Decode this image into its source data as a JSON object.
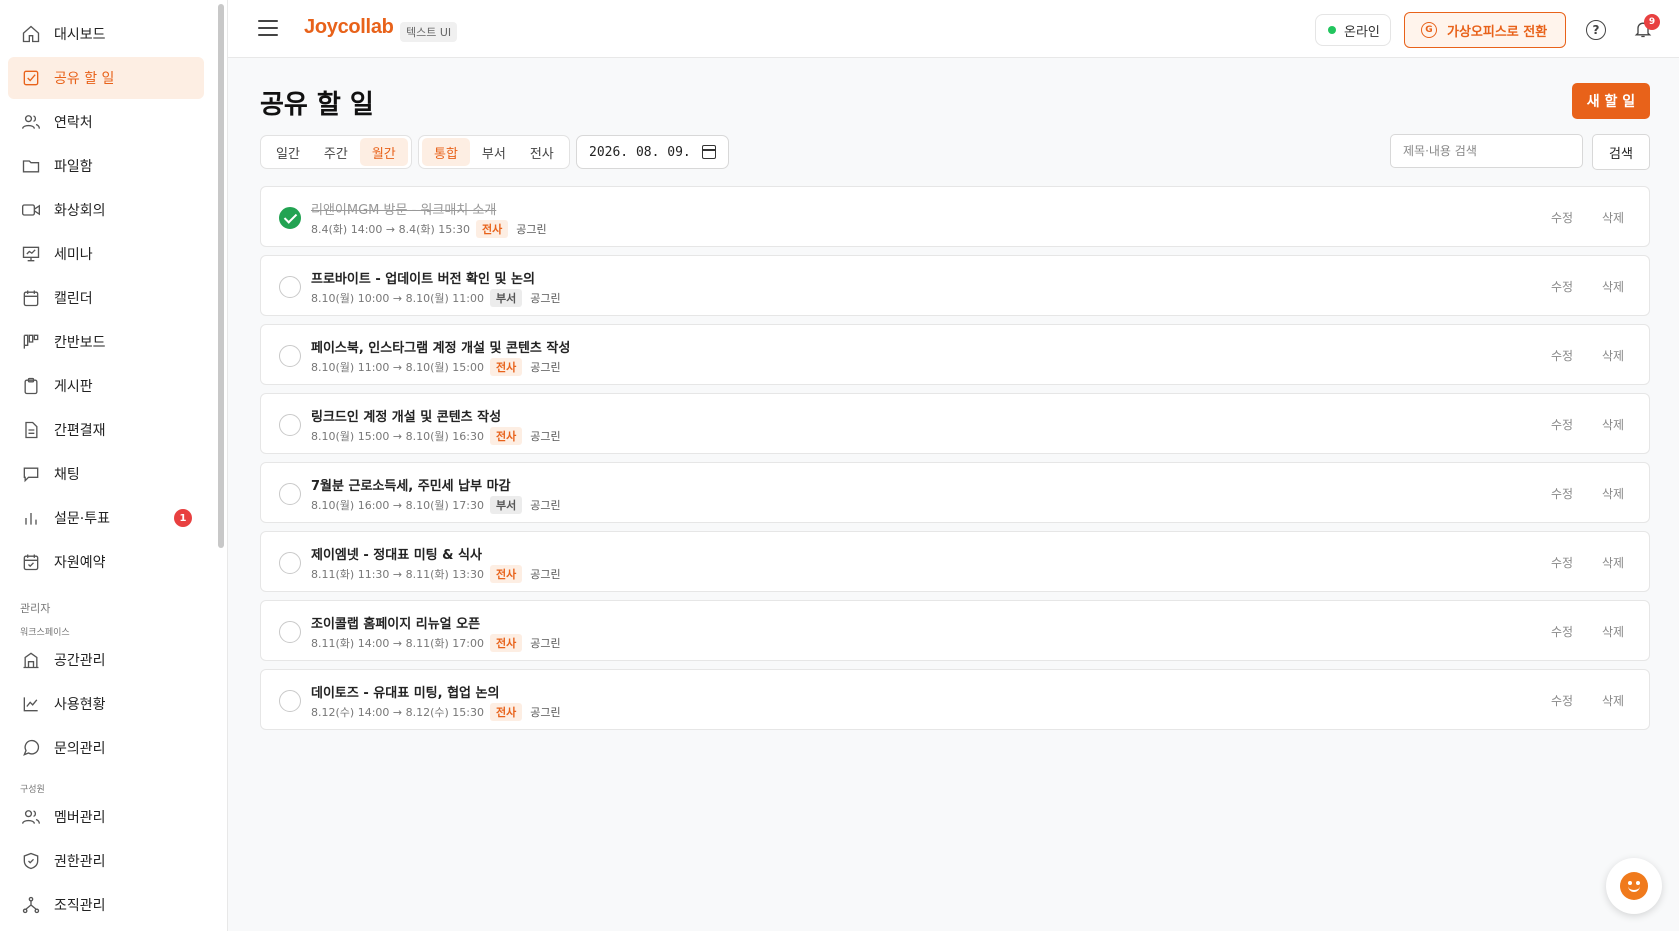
{
  "sidebar": {
    "items": [
      {
        "label": "대시보드",
        "icon": "home-icon"
      },
      {
        "label": "공유 할 일",
        "icon": "checkbox-icon",
        "active": true
      },
      {
        "label": "연락처",
        "icon": "users-icon"
      },
      {
        "label": "파일함",
        "icon": "folder-icon"
      },
      {
        "label": "화상회의",
        "icon": "video-icon"
      },
      {
        "label": "세미나",
        "icon": "presentation-icon"
      },
      {
        "label": "캘린더",
        "icon": "calendar-icon"
      },
      {
        "label": "칸반보드",
        "icon": "kanban-icon"
      },
      {
        "label": "게시판",
        "icon": "clipboard-icon"
      },
      {
        "label": "간편결재",
        "icon": "document-icon"
      },
      {
        "label": "채팅",
        "icon": "chat-icon"
      },
      {
        "label": "설문·투표",
        "icon": "bar-chart-icon",
        "badge": "1"
      },
      {
        "label": "자원예약",
        "icon": "calendar-check-icon"
      }
    ],
    "admin_section": "관리자",
    "workspace_section": "워크스페이스",
    "admin_items": [
      {
        "label": "공간관리",
        "icon": "building-icon"
      },
      {
        "label": "사용현황",
        "icon": "line-chart-icon"
      },
      {
        "label": "문의관리",
        "icon": "message-circle-icon"
      }
    ],
    "member_section": "구성원",
    "member_items": [
      {
        "label": "멤버관리",
        "icon": "users-icon"
      },
      {
        "label": "권한관리",
        "icon": "shield-icon"
      },
      {
        "label": "조직관리",
        "icon": "org-tree-icon"
      }
    ]
  },
  "header": {
    "logo": "Joycollab",
    "logo_tag": "텍스트 UI",
    "status": "온라인",
    "virtual_office": "가상오피스로 전환",
    "help": "?",
    "notification_count": "9"
  },
  "main": {
    "title": "공유 할 일",
    "new_button": "새 할 일",
    "period_tabs": [
      {
        "label": "일간"
      },
      {
        "label": "주간"
      },
      {
        "label": "월간",
        "active": true
      }
    ],
    "scope_tabs": [
      {
        "label": "통합",
        "active": true
      },
      {
        "label": "부서"
      },
      {
        "label": "전사"
      }
    ],
    "date_value": "2026. 08. 09.",
    "search_placeholder": "제목·내용 검색",
    "search_button": "검색",
    "edit_label": "수정",
    "delete_label": "삭제"
  },
  "tasks": [
    {
      "title": "리앤이MGM 방문 - 워크매치 소개",
      "time": "8.4(화) 14:00 → 8.4(화) 15:30",
      "scope": "전사",
      "owner": "공그린",
      "done": true
    },
    {
      "title": "프로바이트 - 업데이트 버전 확인 및 논의",
      "time": "8.10(월) 10:00 → 8.10(월) 11:00",
      "scope": "부서",
      "owner": "공그린",
      "done": false
    },
    {
      "title": "페이스북, 인스타그램 계정 개설 및 콘텐츠 작성",
      "time": "8.10(월) 11:00 → 8.10(월) 15:00",
      "scope": "전사",
      "owner": "공그린",
      "done": false
    },
    {
      "title": "링크드인 계정 개설 및 콘텐츠 작성",
      "time": "8.10(월) 15:00 → 8.10(월) 16:30",
      "scope": "전사",
      "owner": "공그린",
      "done": false
    },
    {
      "title": "7월분 근로소득세, 주민세 납부 마감",
      "time": "8.10(월) 16:00 → 8.10(월) 17:30",
      "scope": "부서",
      "owner": "공그린",
      "done": false
    },
    {
      "title": "제이엠넷 - 정대표 미팅 & 식사",
      "time": "8.11(화) 11:30 → 8.11(화) 13:30",
      "scope": "전사",
      "owner": "공그린",
      "done": false
    },
    {
      "title": "조이콜랩 홈페이지 리뉴얼 오픈",
      "time": "8.11(화) 14:00 → 8.11(화) 17:00",
      "scope": "전사",
      "owner": "공그린",
      "done": false
    },
    {
      "title": "데이토즈 - 유대표 미팅, 협업 논의",
      "time": "8.12(수) 14:00 → 8.12(수) 15:30",
      "scope": "전사",
      "owner": "공그린",
      "done": false
    }
  ],
  "colors": {
    "accent": "#e8621a",
    "success": "#22a352",
    "badge": "#e84040"
  }
}
